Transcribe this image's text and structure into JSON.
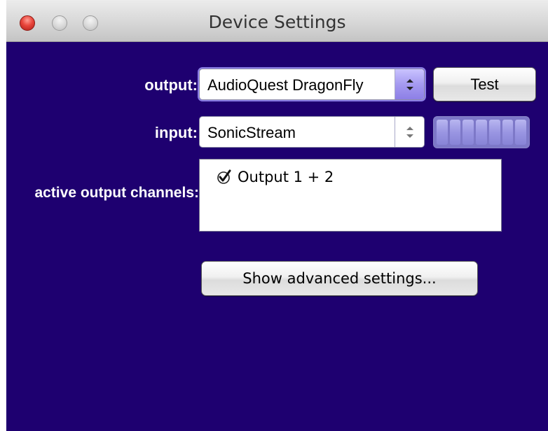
{
  "window": {
    "title": "Device Settings"
  },
  "labels": {
    "output": "output:",
    "input": "input:",
    "active_channels": "active output channels:"
  },
  "output_device": {
    "selected": "AudioQuest DragonFly"
  },
  "input_device": {
    "selected": "SonicStream"
  },
  "buttons": {
    "test": "Test",
    "advanced": "Show advanced settings..."
  },
  "channels": {
    "items": [
      {
        "label": "Output 1 + 2",
        "checked": true
      }
    ]
  },
  "level_meter": {
    "segments": 7,
    "level": 0
  },
  "colors": {
    "window_background": "#1e0070",
    "accent": "#8b7ee6",
    "meter": "#9a96e2"
  },
  "icons": {
    "close": "close-traffic-light",
    "minimize": "minimize-traffic-light",
    "zoom": "zoom-traffic-light",
    "popup_arrows": "up-down-chevron-icon",
    "checkmark": "checkmark-icon"
  }
}
